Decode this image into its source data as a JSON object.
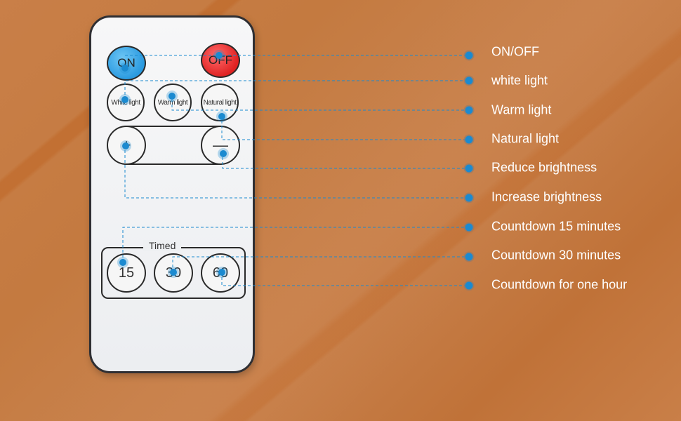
{
  "remote": {
    "power": {
      "on_label": "ON",
      "off_label": "OFF"
    },
    "lights": [
      {
        "label": "White light"
      },
      {
        "label": "Warm light"
      },
      {
        "label": "Natural light"
      }
    ],
    "brightness": {
      "increase_symbol": "+",
      "decrease_symbol": "—"
    },
    "timed": {
      "title": "Timed",
      "buttons": [
        {
          "label": "15"
        },
        {
          "label": "30"
        },
        {
          "label": "60"
        }
      ]
    }
  },
  "callouts": [
    {
      "label": "ON/OFF"
    },
    {
      "label": "white light"
    },
    {
      "label": "Warm light"
    },
    {
      "label": "Natural light"
    },
    {
      "label": "Reduce brightness"
    },
    {
      "label": "Increase brightness"
    },
    {
      "label": "Countdown 15 minutes"
    },
    {
      "label": "Countdown 30 minutes"
    },
    {
      "label": "Countdown for one hour"
    }
  ],
  "colors": {
    "background": "#c4773e",
    "leader_line": "#1b8ad0",
    "marker": "#1b8ad0",
    "label_text": "#ffffff",
    "on_button": "#2a9ae0",
    "off_button": "#e02222"
  }
}
